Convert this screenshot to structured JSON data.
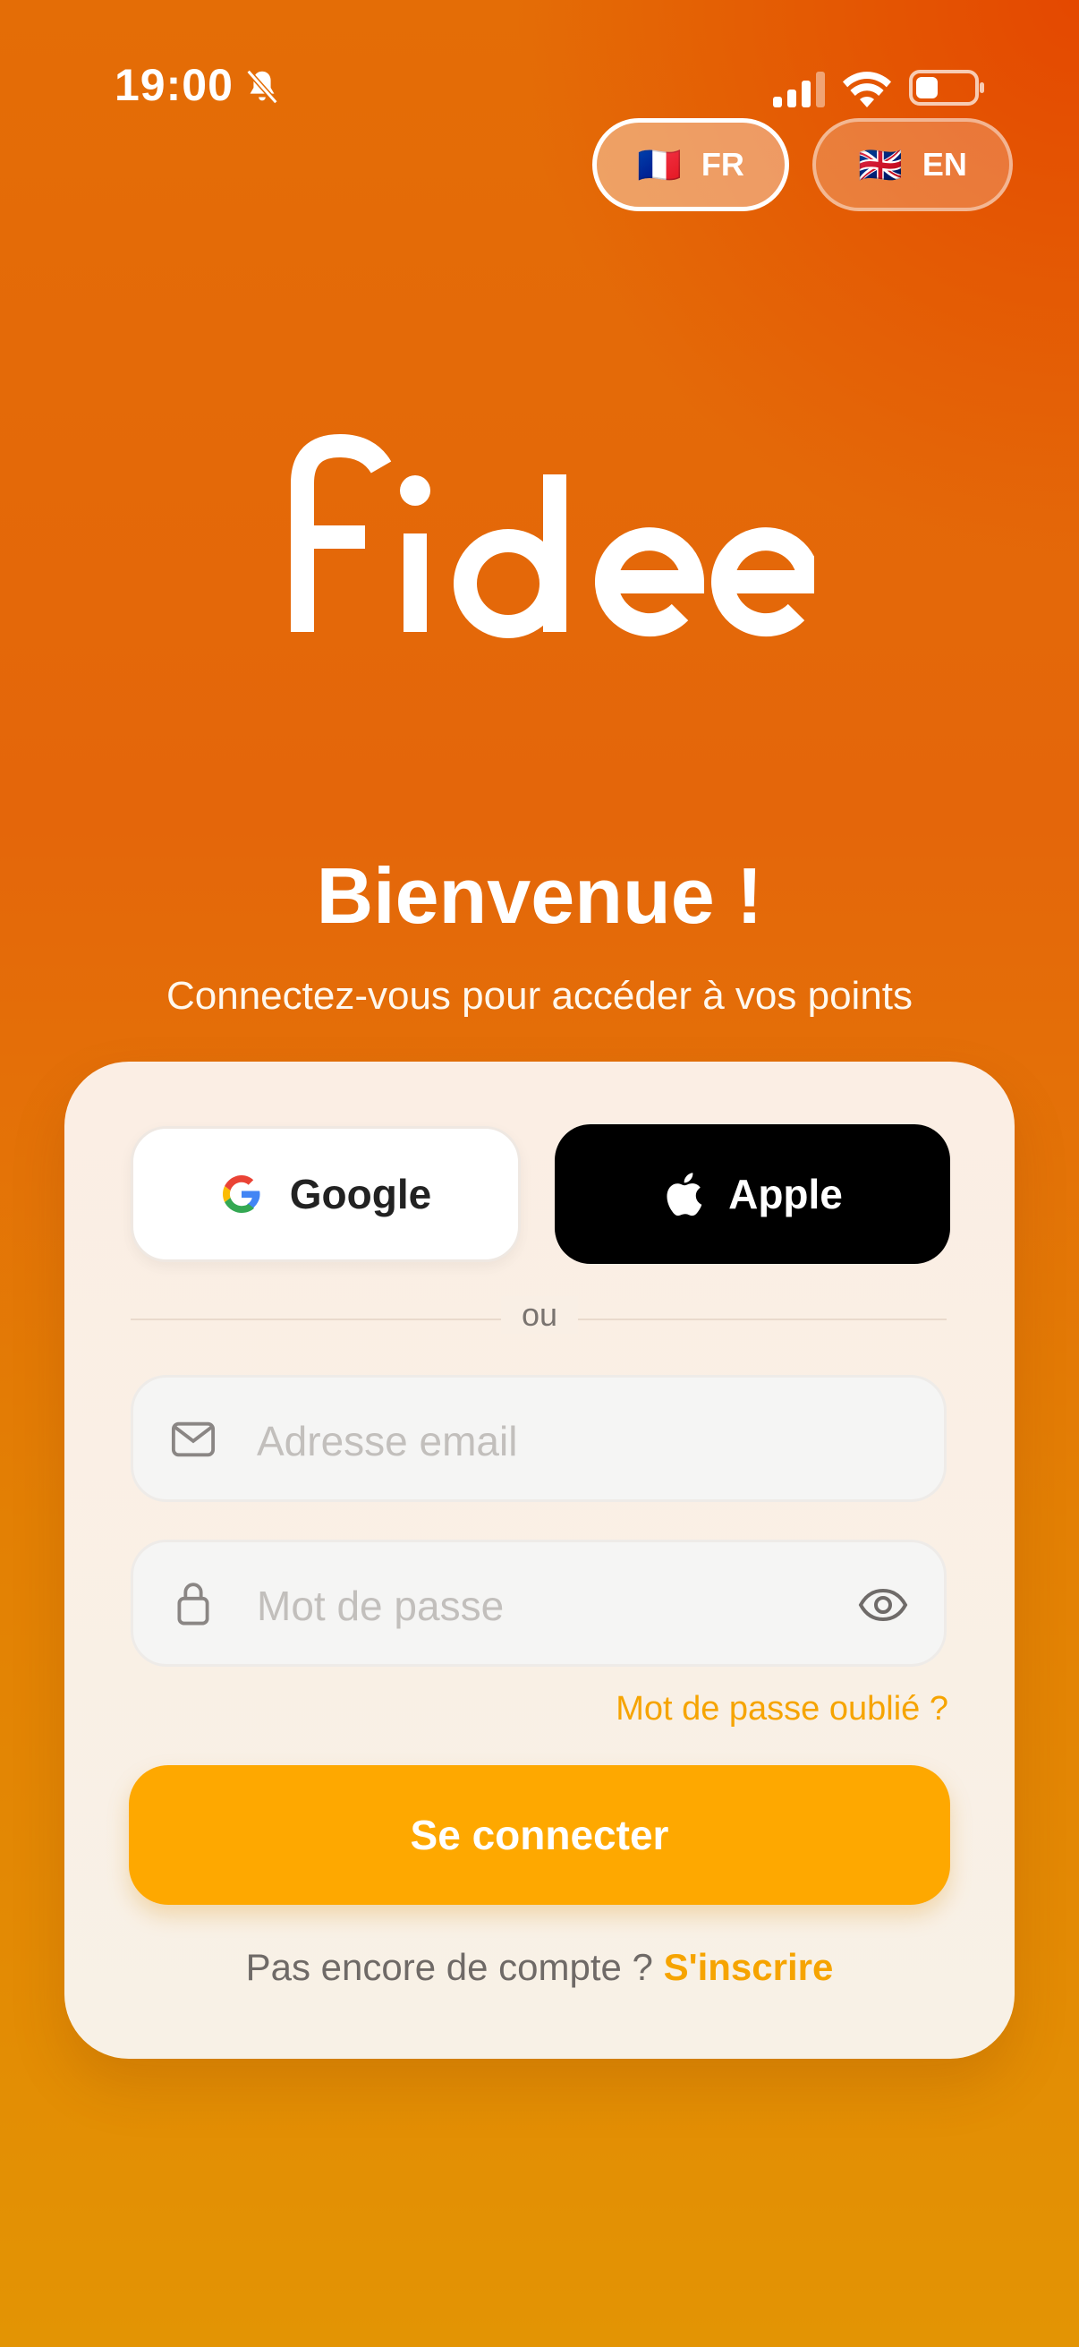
{
  "status_bar": {
    "time": "19:00"
  },
  "languages": [
    {
      "code": "FR",
      "flag": "🇫🇷",
      "selected": true
    },
    {
      "code": "EN",
      "flag": "🇬🇧",
      "selected": false
    }
  ],
  "brand": {
    "logo_text": "fidee"
  },
  "header": {
    "title": "Bienvenue !",
    "subtitle": "Connectez-vous pour accéder à vos points"
  },
  "social": {
    "google_label": "Google",
    "apple_label": "Apple"
  },
  "separator": "ou",
  "form": {
    "email_placeholder": "Adresse email",
    "password_placeholder": "Mot de passe",
    "forgot_label": "Mot de passe oublié ?",
    "submit_label": "Se connecter"
  },
  "footer": {
    "prompt": "Pas encore de compte ? ",
    "signup_label": "S'inscrire"
  },
  "colors": {
    "accent": "#fea800",
    "link": "#f6a400",
    "background_top": "#e4660a",
    "background_bottom": "#e39404"
  }
}
